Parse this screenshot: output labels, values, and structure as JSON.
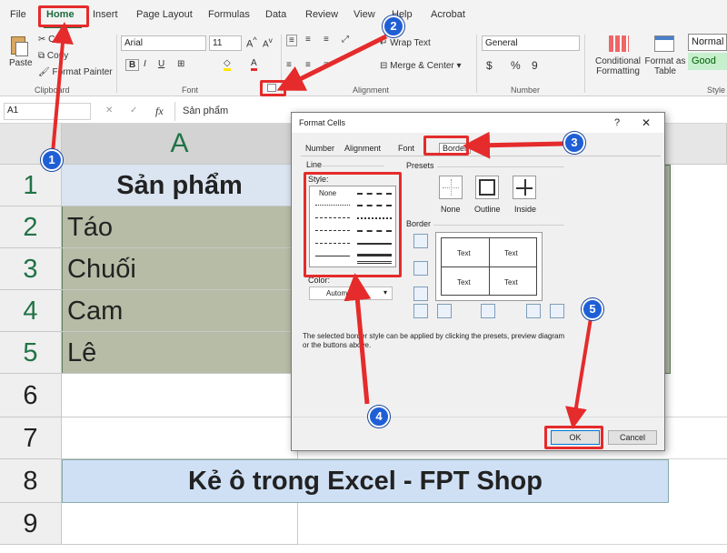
{
  "ribbon_tabs": [
    "File",
    "Home",
    "Insert",
    "Page Layout",
    "Formulas",
    "Data",
    "Review",
    "View",
    "Help",
    "Acrobat"
  ],
  "clipboard": {
    "paste": "Paste",
    "cut": "Cut",
    "copy": "Copy",
    "painter": "Format Painter",
    "label": "Clipboard"
  },
  "font": {
    "name": "Arial",
    "size": "11",
    "label": "Font"
  },
  "alignment": {
    "wrap": "Wrap Text",
    "merge": "Merge & Center",
    "label": "Alignment"
  },
  "number": {
    "format": "General",
    "label": "Number",
    "symbols": [
      "$",
      "%",
      "9"
    ]
  },
  "styles": {
    "conditional": "Conditional Formatting",
    "format_table": "Format as Table",
    "normal": "Normal",
    "good": "Good",
    "label": "Style"
  },
  "formula_bar": {
    "name_box": "A1",
    "fx": "fx",
    "value": "Sản phẩm"
  },
  "sheet": {
    "col_a": "A",
    "rows": [
      "1",
      "2",
      "3",
      "4",
      "5",
      "6",
      "7",
      "8",
      "9"
    ],
    "cells": [
      "Sản phẩm",
      "Táo",
      "Chuối",
      "Cam",
      "Lê"
    ],
    "banner": "Kẻ ô trong Excel - FPT Shop"
  },
  "dialog": {
    "title": "Format Cells",
    "help": "?",
    "close": "✕",
    "tabs": [
      "Number",
      "Alignment",
      "Font",
      "Border"
    ],
    "line": "Line",
    "style": "Style:",
    "none_style": "None",
    "color": "Color:",
    "color_value": "Automatic",
    "presets": "Presets",
    "preset_labels": [
      "None",
      "Outline",
      "Inside"
    ],
    "border": "Border",
    "text": "Text",
    "note": "The selected border style can be applied by clicking the presets, preview diagram or the buttons above.",
    "ok": "OK",
    "cancel": "Cancel"
  },
  "markers": [
    "1",
    "2",
    "3",
    "4",
    "5"
  ],
  "colors": {
    "accent": "#217346",
    "marker": "#1f5fd6",
    "highlight": "#e52b2b",
    "range": "#b7bca6",
    "banner": "#cfe0f5"
  }
}
